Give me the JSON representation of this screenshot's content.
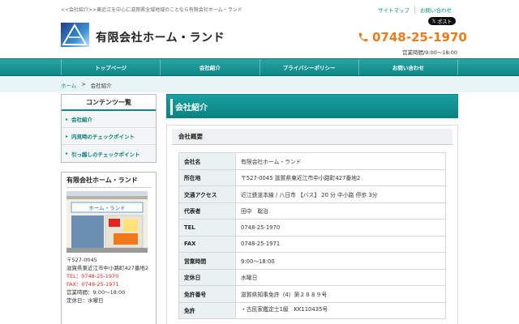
{
  "header": {
    "tagline": "<<会社紹介>>東近江を中心に滋賀県全域地域のことなら有限会社ホーム・ランド",
    "links": [
      "サイトマップ",
      "お問い合わせ"
    ],
    "xpost_label": "ポスト",
    "brand": "有限会社ホーム・ランド",
    "phone": "0748-25-1970",
    "hours": "営業時間/9:00～18:00"
  },
  "nav": [
    "トップページ",
    "会社紹介",
    "プライバシーポリシー",
    "お問い合わせ"
  ],
  "breadcrumb": {
    "home": "ホーム",
    "sep": ">",
    "current": "会社紹介"
  },
  "sidebar": {
    "title": "コンテンツ一覧",
    "items": [
      "会社紹介",
      "内見時のチェックポイント",
      "引っ越しのチェックポイント"
    ],
    "company": {
      "name": "有限会社ホーム・ランド",
      "zip": "〒527-0045",
      "address": "滋賀県東近江市中小路町427番地2",
      "tel": "TEL：0748-25-1970",
      "fax": "FAX：0748-25-1971",
      "hours": "営業時間：9:00～18:00",
      "holiday": "定休日：水曜日",
      "sign_text": "ホーム・ランド"
    }
  },
  "main": {
    "title": "会社紹介",
    "section": "会社概要",
    "rows": [
      {
        "label": "会社名",
        "value": "有限会社ホーム・ランド"
      },
      {
        "label": "所在地",
        "value": "〒527-0045 滋賀県東近江市中小路町427番地2"
      },
      {
        "label": "交通アクセス",
        "value": "近江鉄道本線 / 八日市 【バス】 20 分 中小路 停歩 3分"
      },
      {
        "label": "代表者",
        "value": "田中　聡治"
      },
      {
        "label": "TEL",
        "value": "0748-25-1970"
      },
      {
        "label": "FAX",
        "value": "0748-25-1971"
      },
      {
        "label": "営業時間",
        "value": "9:00～18:00"
      },
      {
        "label": "定休日",
        "value": "水曜日"
      },
      {
        "label": "免許番号",
        "value": "滋賀県知事免許（4）第２８８９号"
      },
      {
        "label": "免許",
        "value": "・古民家鑑定士1級　KK110435号"
      }
    ]
  },
  "colors": {
    "accent": "#0e8787",
    "phone": "#f07a1a",
    "red": "#e2261b"
  }
}
